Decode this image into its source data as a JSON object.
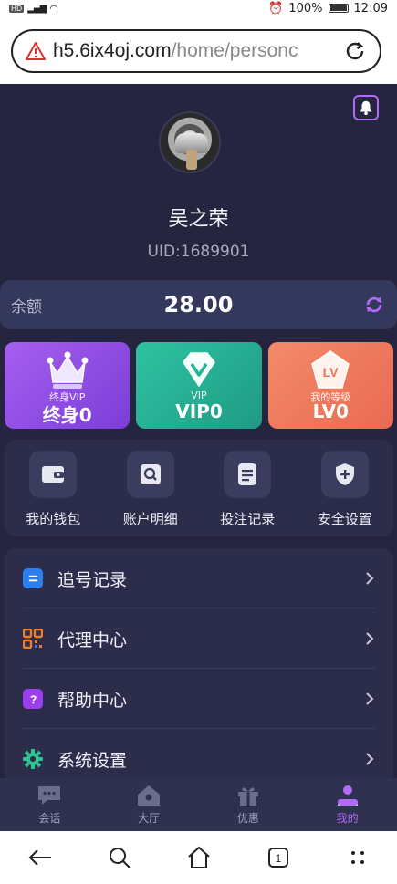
{
  "status": {
    "battery": "100%",
    "time": "12:09"
  },
  "browser": {
    "url_host": "h5.6ix4oj.com",
    "url_path": "/home/personc"
  },
  "profile": {
    "name": "吴之荣",
    "uid": "UID:1689901"
  },
  "balance": {
    "label": "余额",
    "amount": "28.00"
  },
  "cards": [
    {
      "small": "终身VIP",
      "big": "终身0",
      "emblem": "crown-icon"
    },
    {
      "small": "VIP",
      "big": "VIP0",
      "emblem": "diamond-icon"
    },
    {
      "small": "我的等级",
      "big": "LV0",
      "emblem_text": "LV"
    }
  ],
  "quick": [
    {
      "label": "我的钱包",
      "icon": "wallet-icon"
    },
    {
      "label": "账户明细",
      "icon": "search-icon"
    },
    {
      "label": "投注记录",
      "icon": "document-icon"
    },
    {
      "label": "安全设置",
      "icon": "shield-icon"
    }
  ],
  "menu": [
    {
      "label": "追号记录",
      "icon": "list-icon",
      "color": "#2b7ff0"
    },
    {
      "label": "代理中心",
      "icon": "qr-icon",
      "color": "#f07a2e"
    },
    {
      "label": "帮助中心",
      "icon": "question-icon",
      "color": "#9b3ef0"
    },
    {
      "label": "系统设置",
      "icon": "gear-icon",
      "color": "#2fc28e"
    }
  ],
  "tabs": [
    {
      "label": "会话",
      "icon": "chat-icon"
    },
    {
      "label": "大厅",
      "icon": "home-icon"
    },
    {
      "label": "优惠",
      "icon": "gift-icon"
    },
    {
      "label": "我的",
      "icon": "user-icon",
      "active": true
    }
  ],
  "nav": {
    "tab_count": "1"
  },
  "colors": {
    "accent": "#b06cf5",
    "bg": "#25253f",
    "panel": "#2b2d4a"
  }
}
